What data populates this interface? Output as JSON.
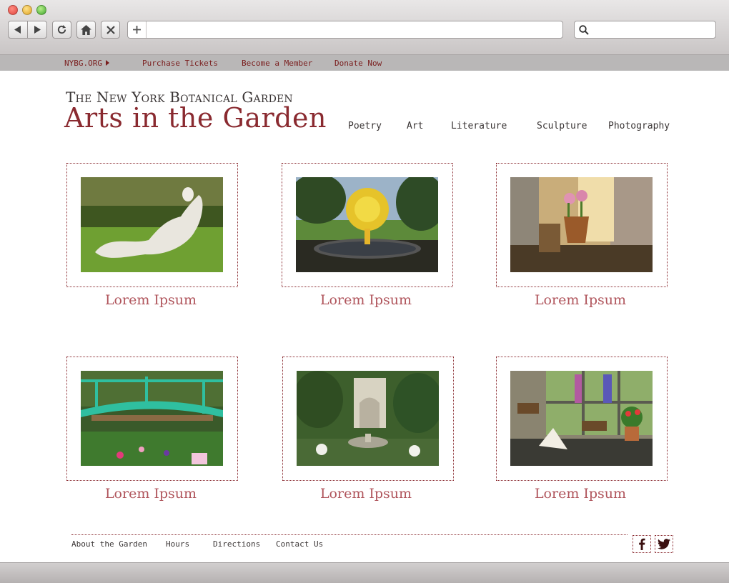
{
  "browser": {
    "back_icon": "back-arrow-icon",
    "forward_icon": "forward-arrow-icon",
    "reload_icon": "reload-icon",
    "home_icon": "home-icon",
    "stop_icon": "close-icon",
    "new_tab_icon": "plus-icon",
    "search_icon": "search-icon",
    "address_value": "",
    "search_value": ""
  },
  "topbar": {
    "nybg": "NYBG.ORG",
    "tickets": "Purchase Tickets",
    "member": "Become a Member",
    "donate": "Donate Now"
  },
  "header": {
    "org": "The New York Botanical Garden",
    "title": "Arts in the Garden"
  },
  "nav": {
    "items": [
      "Poetry",
      "Art",
      "Literature",
      "Sculpture",
      "Photography"
    ]
  },
  "gallery": {
    "items": [
      {
        "caption": "Lorem Ipsum"
      },
      {
        "caption": "Lorem Ipsum"
      },
      {
        "caption": "Lorem Ipsum"
      },
      {
        "caption": "Lorem Ipsum"
      },
      {
        "caption": "Lorem Ipsum"
      },
      {
        "caption": "Lorem Ipsum"
      }
    ]
  },
  "footer": {
    "links": [
      "About the Garden",
      "Hours",
      "Directions",
      "Contact Us"
    ],
    "social": [
      "facebook-icon",
      "twitter-icon"
    ]
  },
  "colors": {
    "brand": "#8a2a30",
    "caption": "#b0555c",
    "topbar_bg": "#b9b7b7"
  }
}
